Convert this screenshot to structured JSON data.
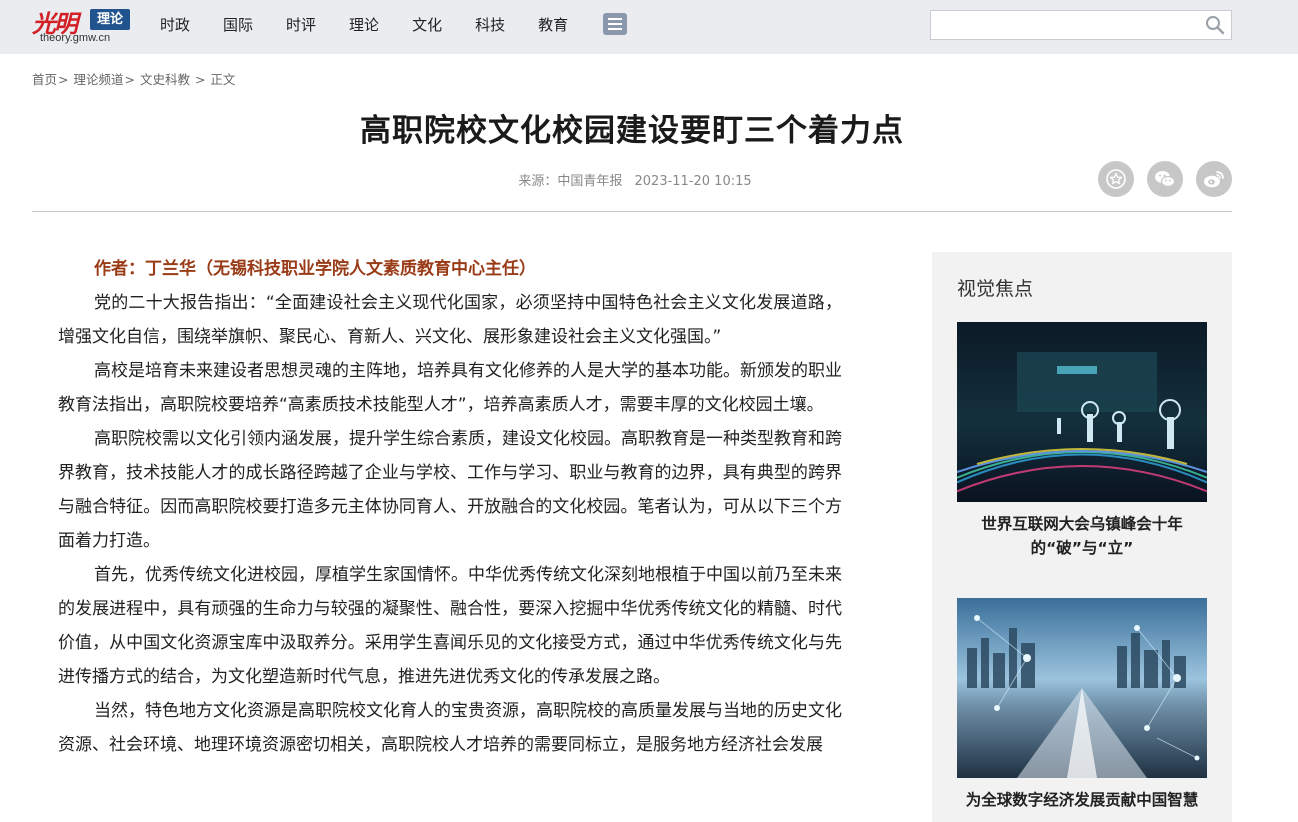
{
  "header": {
    "logo_text": "光明",
    "logo_badge": "理论",
    "logo_url": "theory.gmw.cn",
    "nav": [
      "时政",
      "国际",
      "时评",
      "理论",
      "文化",
      "科技",
      "教育"
    ],
    "search_placeholder": ""
  },
  "breadcrumb": {
    "items": [
      "首页",
      "理论频道",
      "文史科教",
      "正文"
    ]
  },
  "article": {
    "title": "高职院校文化校园建设要盯三个着力点",
    "source_label": "来源：",
    "source": "中国青年报",
    "datetime": "2023-11-20 10:15",
    "author": "作者：丁兰华（无锡科技职业学院人文素质教育中心主任）",
    "paragraphs": [
      "党的二十大报告指出：“全面建设社会主义现代化国家，必须坚持中国特色社会主义文化发展道路，增强文化自信，围绕举旗帜、聚民心、育新人、兴文化、展形象建设社会主义文化强国。”",
      "高校是培育未来建设者思想灵魂的主阵地，培养具有文化修养的人是大学的基本功能。新颁发的职业教育法指出，高职院校要培养“高素质技术技能型人才”，培养高素质人才，需要丰厚的文化校园土壤。",
      "高职院校需以文化引领内涵发展，提升学生综合素质，建设文化校园。高职教育是一种类型教育和跨界教育，技术技能人才的成长路径跨越了企业与学校、工作与学习、职业与教育的边界，具有典型的跨界与融合特征。因而高职院校要打造多元主体协同育人、开放融合的文化校园。笔者认为，可从以下三个方面着力打造。",
      "首先，优秀传统文化进校园，厚植学生家国情怀。中华优秀传统文化深刻地根植于中国以前乃至未来的发展进程中，具有顽强的生命力与较强的凝聚性、融合性，要深入挖掘中华优秀传统文化的精髓、时代价值，从中国文化资源宝库中汲取养分。采用学生喜闻乐见的文化接受方式，通过中华优秀传统文化与先进传播方式的结合，为文化塑造新时代气息，推进先进优秀文化的传承发展之路。",
      "当然，特色地方文化资源是高职院校文化育人的宝贵资源，高职院校的高质量发展与当地的历史文化资源、社会环境、地理环境资源密切相关，高职院校人才培养的需要同标立，是服务地方经济社会发展"
    ]
  },
  "sidebar": {
    "title": "视觉焦点",
    "items": [
      {
        "caption": "世界互联网大会乌镇峰会十年的“破”与“立”"
      },
      {
        "caption": "为全球数字经济发展贡献中国智慧"
      }
    ]
  },
  "colors": {
    "topbar_bg": "#eaecef",
    "logo_red": "#d31f26",
    "logo_badge_blue": "#21538e",
    "author_color": "#9a3b17",
    "sidebar_bg": "#f2f2f2"
  }
}
